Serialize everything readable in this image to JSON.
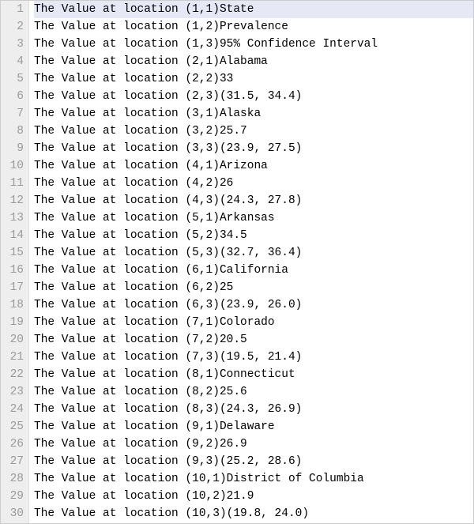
{
  "editor": {
    "current_line": 1,
    "line_prefix": "The Value at location ",
    "lines": [
      {
        "n": 1,
        "loc": "(1,1)",
        "val": "State"
      },
      {
        "n": 2,
        "loc": "(1,2)",
        "val": "Prevalence"
      },
      {
        "n": 3,
        "loc": "(1,3)",
        "val": "95% Confidence Interval"
      },
      {
        "n": 4,
        "loc": "(2,1)",
        "val": "Alabama"
      },
      {
        "n": 5,
        "loc": "(2,2)",
        "val": "33"
      },
      {
        "n": 6,
        "loc": "(2,3)",
        "val": "(31.5, 34.4)"
      },
      {
        "n": 7,
        "loc": "(3,1)",
        "val": "Alaska"
      },
      {
        "n": 8,
        "loc": "(3,2)",
        "val": "25.7"
      },
      {
        "n": 9,
        "loc": "(3,3)",
        "val": "(23.9, 27.5)"
      },
      {
        "n": 10,
        "loc": "(4,1)",
        "val": "Arizona"
      },
      {
        "n": 11,
        "loc": "(4,2)",
        "val": "26"
      },
      {
        "n": 12,
        "loc": "(4,3)",
        "val": "(24.3, 27.8)"
      },
      {
        "n": 13,
        "loc": "(5,1)",
        "val": "Arkansas"
      },
      {
        "n": 14,
        "loc": "(5,2)",
        "val": "34.5"
      },
      {
        "n": 15,
        "loc": "(5,3)",
        "val": "(32.7, 36.4)"
      },
      {
        "n": 16,
        "loc": "(6,1)",
        "val": "California"
      },
      {
        "n": 17,
        "loc": "(6,2)",
        "val": "25"
      },
      {
        "n": 18,
        "loc": "(6,3)",
        "val": "(23.9, 26.0)"
      },
      {
        "n": 19,
        "loc": "(7,1)",
        "val": "Colorado"
      },
      {
        "n": 20,
        "loc": "(7,2)",
        "val": "20.5"
      },
      {
        "n": 21,
        "loc": "(7,3)",
        "val": "(19.5, 21.4)"
      },
      {
        "n": 22,
        "loc": "(8,1)",
        "val": "Connecticut"
      },
      {
        "n": 23,
        "loc": "(8,2)",
        "val": "25.6"
      },
      {
        "n": 24,
        "loc": "(8,3)",
        "val": "(24.3, 26.9)"
      },
      {
        "n": 25,
        "loc": "(9,1)",
        "val": "Delaware"
      },
      {
        "n": 26,
        "loc": "(9,2)",
        "val": "26.9"
      },
      {
        "n": 27,
        "loc": "(9,3)",
        "val": "(25.2, 28.6)"
      },
      {
        "n": 28,
        "loc": "(10,1)",
        "val": "District of Columbia"
      },
      {
        "n": 29,
        "loc": "(10,2)",
        "val": "21.9"
      },
      {
        "n": 30,
        "loc": "(10,3)",
        "val": "(19.8, 24.0)"
      }
    ]
  },
  "chart_data": {
    "type": "table",
    "title": "",
    "columns": [
      "State",
      "Prevalence",
      "95% Confidence Interval"
    ],
    "rows": [
      [
        "Alabama",
        33,
        "(31.5, 34.4)"
      ],
      [
        "Alaska",
        25.7,
        "(23.9, 27.5)"
      ],
      [
        "Arizona",
        26,
        "(24.3, 27.8)"
      ],
      [
        "Arkansas",
        34.5,
        "(32.7, 36.4)"
      ],
      [
        "California",
        25,
        "(23.9, 26.0)"
      ],
      [
        "Colorado",
        20.5,
        "(19.5, 21.4)"
      ],
      [
        "Connecticut",
        25.6,
        "(24.3, 26.9)"
      ],
      [
        "Delaware",
        26.9,
        "(25.2, 28.6)"
      ],
      [
        "District of Columbia",
        21.9,
        "(19.8, 24.0)"
      ]
    ]
  }
}
